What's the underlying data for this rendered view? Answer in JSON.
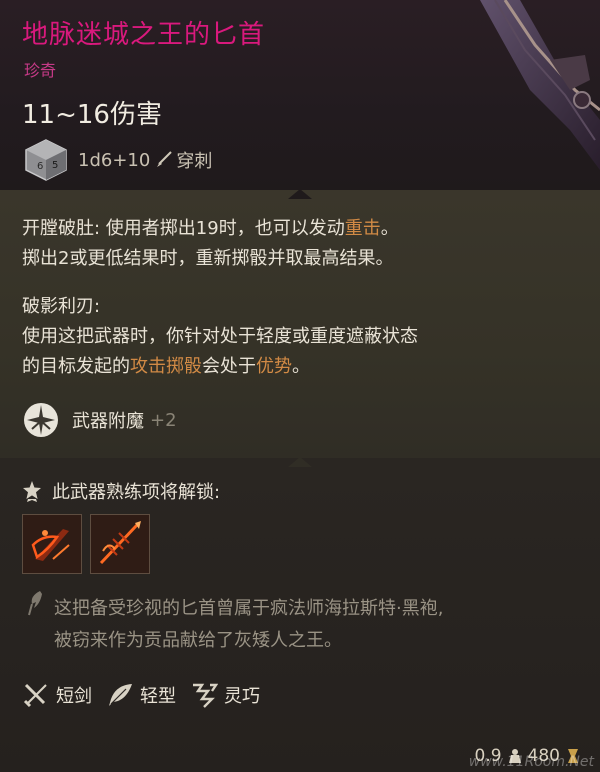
{
  "item": {
    "name": "地脉迷城之王的匕首",
    "rarity": "珍奇",
    "damage": "11~16伤害",
    "dice": "1d6+10",
    "damage_type": "穿刺",
    "rarity_color": "#d9197d"
  },
  "properties": {
    "ability1": {
      "name": "开膛破肚:",
      "l1_a": " 使用者掷出19时，也可以发动",
      "l1_hl": "重击",
      "l1_b": "。",
      "l2": "掷出2或更低结果时，重新掷骰并取最高结果。"
    },
    "ability2": {
      "name": "破影利刃:",
      "l1": "使用这把武器时，你针对处于轻度或重度遮蔽状态",
      "l2_a": "的目标发起的",
      "l2_hl1": "攻击掷骰",
      "l2_b": "会处于",
      "l2_hl2": "优势",
      "l2_c": "。"
    },
    "enchant": {
      "label": "武器附魔",
      "bonus": "+2",
      "icon": "enchant-icon"
    }
  },
  "proficiency": {
    "title": "此武器熟练项将解锁:",
    "actions": [
      {
        "icon": "slash-action-icon"
      },
      {
        "icon": "pierce-action-icon"
      }
    ]
  },
  "flavor": {
    "line1": "这把备受珍视的匕首曾属于疯法师海拉斯特·黑袍,",
    "line2": "被窃来作为贡品献给了灰矮人之王。"
  },
  "tags": [
    {
      "label": "短剑",
      "icon": "short-sword-icon"
    },
    {
      "label": "轻型",
      "icon": "feather-icon"
    },
    {
      "label": "灵巧",
      "icon": "finesse-icon"
    }
  ],
  "footer": {
    "weight": "0.9",
    "price": "480"
  },
  "watermark": "www.11Room.Net"
}
